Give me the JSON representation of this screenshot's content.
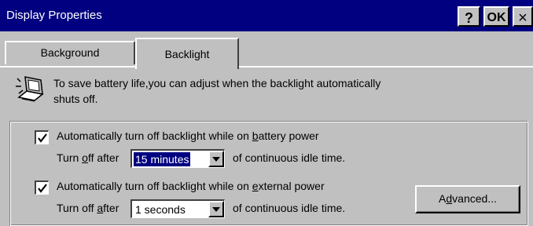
{
  "window": {
    "title": "Display Properties",
    "help_label": "?",
    "ok_label": "OK",
    "close_label": "×"
  },
  "tabs": [
    {
      "label": "Background",
      "active": false
    },
    {
      "label": "Backlight",
      "active": true
    }
  ],
  "info": {
    "line1": "To save battery life,you can adjust when the backlight automatically",
    "line2": "shuts off."
  },
  "battery": {
    "checked": true,
    "label_pre": "Automatically turn off backlight while on ",
    "label_key": "b",
    "label_post": "attery power",
    "turnoff_pre": "Turn ",
    "turnoff_key": "o",
    "turnoff_post": "ff after",
    "value": "15 minutes",
    "suffix": "of continuous idle time."
  },
  "external": {
    "checked": true,
    "label_pre": "Automatically turn off backlight while on ",
    "label_key": "e",
    "label_post": "xternal power",
    "turnoff_pre": "Turn off ",
    "turnoff_key": "a",
    "turnoff_post": "fter",
    "value": "1 seconds",
    "suffix": "of continuous idle time."
  },
  "advanced": {
    "pre": "A",
    "key": "d",
    "post": "vanced..."
  },
  "colors": {
    "titlebar": "#000080",
    "face": "#c0c0c0",
    "selection": "#000080"
  },
  "icons": [
    "help-icon",
    "close-icon",
    "backlight-laptop-icon",
    "checkmark-icon",
    "dropdown-arrow-icon"
  ]
}
